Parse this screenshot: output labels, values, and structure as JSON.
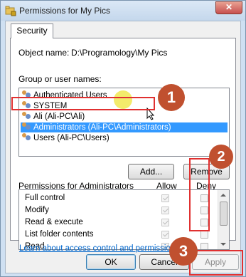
{
  "window": {
    "title": "Permissions for My Pics",
    "close_label": "✕"
  },
  "tabs": [
    {
      "label": "Security"
    }
  ],
  "object": {
    "label": "Object name:",
    "value": "D:\\Programology\\My Pics"
  },
  "groups": {
    "label": "Group or user names:",
    "items": [
      {
        "label": "Authenticated Users",
        "selected": false
      },
      {
        "label": "SYSTEM",
        "selected": false
      },
      {
        "label": "Ali (Ali-PC\\Ali)",
        "selected": false
      },
      {
        "label": "Administrators (Ali-PC\\Administrators)",
        "selected": true
      },
      {
        "label": "Users (Ali-PC\\Users)",
        "selected": false
      }
    ]
  },
  "buttons": {
    "add": "Add...",
    "remove": "Remove",
    "ok": "OK",
    "cancel": "Cancel",
    "apply": "Apply"
  },
  "permissions": {
    "header": "Permissions for Administrators",
    "allow_header": "Allow",
    "deny_header": "Deny",
    "rows": [
      {
        "label": "Full control",
        "allow": true,
        "deny": false
      },
      {
        "label": "Modify",
        "allow": true,
        "deny": false
      },
      {
        "label": "Read & execute",
        "allow": true,
        "deny": false
      },
      {
        "label": "List folder contents",
        "allow": true,
        "deny": false
      },
      {
        "label": "Read",
        "allow": true,
        "deny": false
      }
    ]
  },
  "link": "Learn about access control and permissions",
  "annotations": [
    {
      "label": "1"
    },
    {
      "label": "2"
    },
    {
      "label": "3"
    }
  ],
  "colors": {
    "selection": "#3399ff",
    "annotation_red": "#e03030",
    "badge": "#c0502f",
    "link": "#0066cc"
  }
}
